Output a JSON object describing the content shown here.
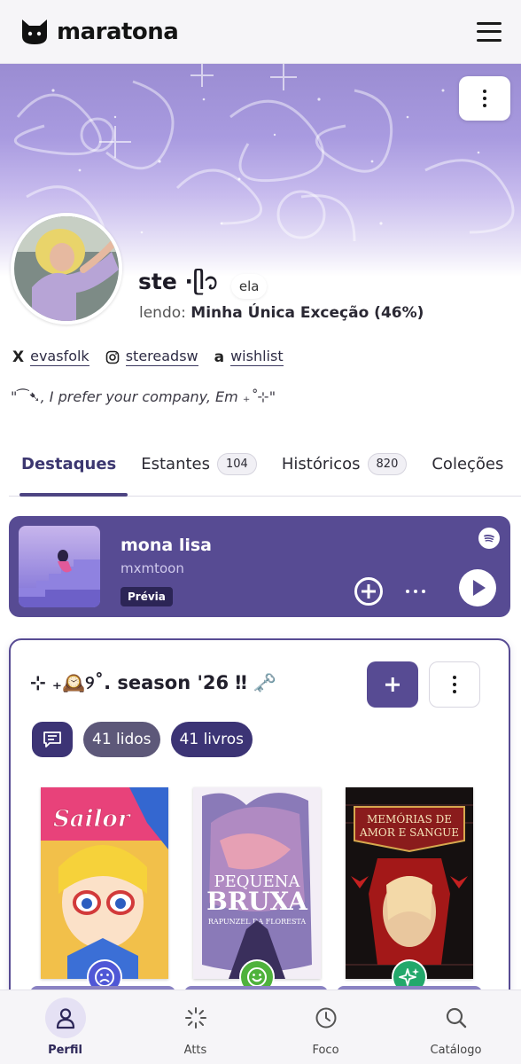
{
  "header": {
    "brand": "maratona"
  },
  "profile": {
    "username": "ste ⋅ᥫ᭡",
    "pronoun": "ela",
    "reading_label": "lendo:",
    "reading_book": "Minha Única Exceção (46%)",
    "bio": "\"⁀➷, I prefer your company, Em ₊˚⊹\""
  },
  "socials": [
    {
      "icon": "x-icon",
      "glyph": "X",
      "label": "evasfolk"
    },
    {
      "icon": "instagram-icon",
      "glyph": "",
      "label": "stereadsw"
    },
    {
      "icon": "amazon-icon",
      "glyph": "a",
      "label": "wishlist"
    }
  ],
  "tabs": [
    {
      "label": "Destaques",
      "count": ""
    },
    {
      "label": "Estantes",
      "count": "104"
    },
    {
      "label": "Históricos",
      "count": "820"
    },
    {
      "label": "Coleções",
      "count": ""
    }
  ],
  "spotify": {
    "title": "mona lisa",
    "artist": "mxmtoon",
    "badge": "Prévia"
  },
  "season": {
    "title": "⊹ ₊🕰️୨˚. season '26 ‼ 🗝️",
    "read_chip": "41 lidos",
    "books_chip": "41 livros"
  },
  "books": [
    {
      "name": "sailor-v-cover",
      "title": "Sailor V",
      "mood": "sad-face-icon",
      "mood_color": "#4f57d6"
    },
    {
      "name": "pequena-bruxa-cover",
      "title": "Pequena Bruxa",
      "subtitle": "Rapunzel da Floresta",
      "mood": "smile-face-icon",
      "mood_color": "#4fb23c"
    },
    {
      "name": "memorias-cover",
      "title": "Memórias de Amor e Sangue",
      "mood": "sparkles-icon",
      "mood_color": "#23a86b"
    }
  ],
  "bottom_nav": [
    {
      "label": "Perfil",
      "icon": "profile-icon",
      "active": true
    },
    {
      "label": "Atts",
      "icon": "updates-icon",
      "active": false
    },
    {
      "label": "Foco",
      "icon": "clock-icon",
      "active": false
    },
    {
      "label": "Catálogo",
      "icon": "search-icon",
      "active": false
    }
  ],
  "colors": {
    "accent": "#574b93",
    "accent_dark": "#3c3475",
    "tab_active": "#4d4482"
  }
}
